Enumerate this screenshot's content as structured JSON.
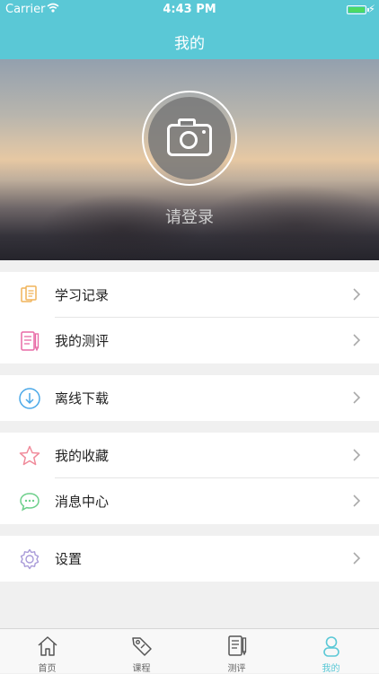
{
  "status_bar": {
    "carrier": "Carrier",
    "time": "4:43 PM"
  },
  "nav": {
    "title": "我的"
  },
  "profile": {
    "login_text": "请登录"
  },
  "menu": {
    "groups": [
      {
        "items": [
          {
            "label": "学习记录",
            "icon": "study-record-icon"
          },
          {
            "label": "我的测评",
            "icon": "my-assessment-icon"
          }
        ]
      },
      {
        "items": [
          {
            "label": "离线下载",
            "icon": "download-icon"
          }
        ]
      },
      {
        "items": [
          {
            "label": "我的收藏",
            "icon": "star-icon"
          },
          {
            "label": "消息中心",
            "icon": "message-icon"
          }
        ]
      },
      {
        "items": [
          {
            "label": "设置",
            "icon": "gear-icon"
          }
        ]
      }
    ]
  },
  "tabbar": {
    "tabs": [
      {
        "label": "首页",
        "icon": "home-icon"
      },
      {
        "label": "课程",
        "icon": "tag-icon"
      },
      {
        "label": "测评",
        "icon": "assessment-icon"
      },
      {
        "label": "我的",
        "icon": "person-icon"
      }
    ],
    "active_index": 3
  },
  "colors": {
    "accent": "#5ac8d6",
    "battery": "#4cd964"
  }
}
